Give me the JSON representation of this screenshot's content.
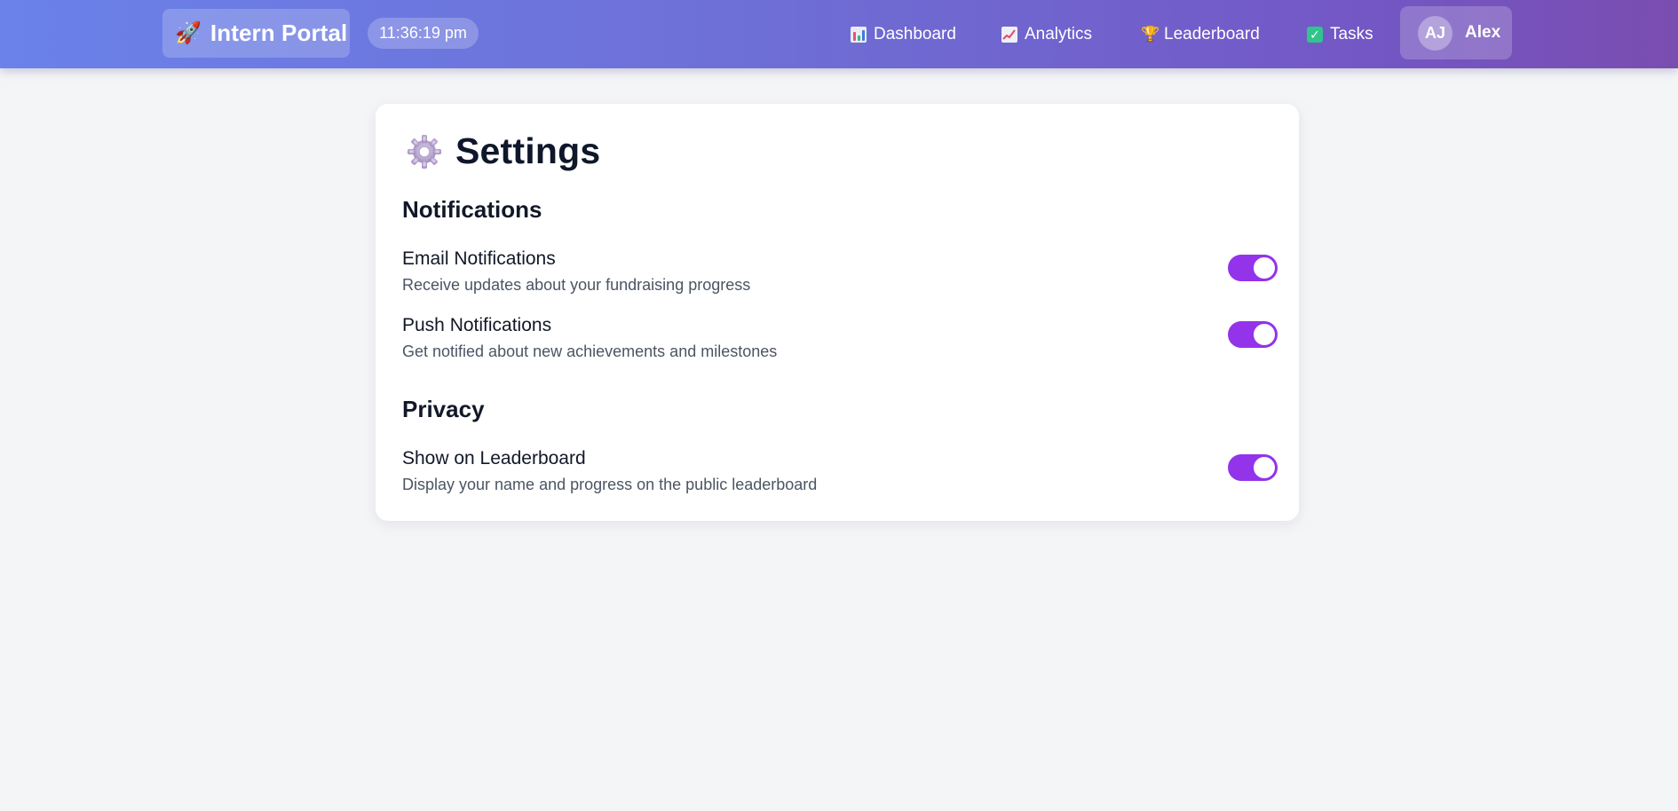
{
  "header": {
    "brand_icon": "rocket-icon",
    "brand_icon_glyph": "🚀",
    "brand_title": "Intern Portal",
    "clock": "11:36:19 pm",
    "nav": [
      {
        "label": "Dashboard",
        "icon": "bar-chart-icon"
      },
      {
        "label": "Analytics",
        "icon": "line-chart-icon"
      },
      {
        "label": "Leaderboard",
        "icon": "trophy-icon"
      },
      {
        "label": "Tasks",
        "icon": "checkbox-icon"
      }
    ],
    "user": {
      "initials": "AJ",
      "name": "Alex"
    }
  },
  "settings": {
    "title": "Settings",
    "title_icon": "gear-icon",
    "sections": [
      {
        "title": "Notifications",
        "items": [
          {
            "label": "Email Notifications",
            "description": "Receive updates about your fundraising progress",
            "enabled": true
          },
          {
            "label": "Push Notifications",
            "description": "Get notified about new achievements and milestones",
            "enabled": true
          }
        ]
      },
      {
        "title": "Privacy",
        "items": [
          {
            "label": "Show on Leaderboard",
            "description": "Display your name and progress on the public leaderboard",
            "enabled": true
          }
        ]
      }
    ]
  },
  "colors": {
    "accent": "#9333ea",
    "header_gradient_start": "#6a82ea",
    "header_gradient_end": "#7a4db0",
    "page_background": "#f4f5f7"
  }
}
